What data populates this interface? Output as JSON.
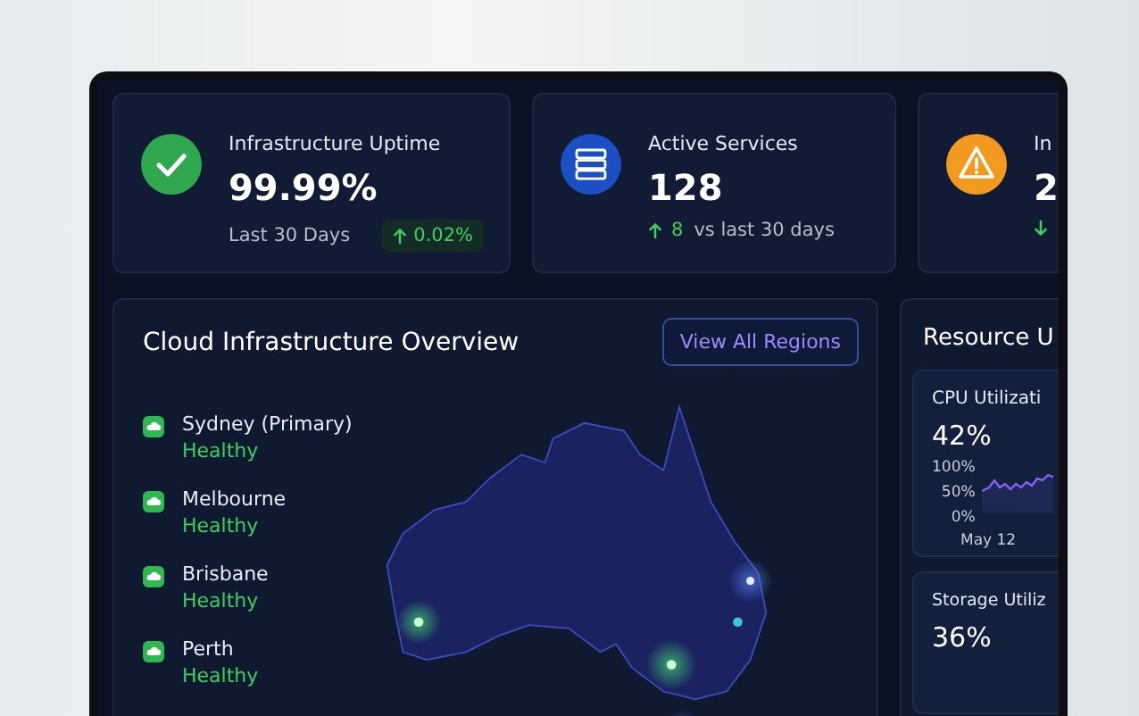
{
  "stat_cards": [
    {
      "kind": "success",
      "title": "Infrastructure Uptime",
      "value": "99.99%",
      "caption": "Last 30 Days",
      "delta": "0.02%",
      "rising": true,
      "highlighted": true
    },
    {
      "kind": "info",
      "title": "Active Services",
      "value": "128",
      "caption": "vs last 30 days",
      "delta": "8",
      "rising": true,
      "highlighted": false
    },
    {
      "kind": "warning",
      "title": "In",
      "value": "2",
      "rising": false,
      "highlighted": false
    }
  ],
  "overview": {
    "title": "Cloud Infrastructure Overview",
    "button": "View All Regions",
    "regions": [
      {
        "name": "Sydney (Primary)",
        "status": "Healthy"
      },
      {
        "name": "Melbourne",
        "status": "Healthy"
      },
      {
        "name": "Brisbane",
        "status": "Healthy"
      },
      {
        "name": "Perth",
        "status": "Healthy"
      }
    ]
  },
  "resources": {
    "title": "Resource U",
    "metrics": [
      {
        "title": "CPU Utilizati",
        "value": "42%",
        "axis_labels": [
          "100%",
          "50%",
          "0%"
        ],
        "date": "May 12"
      },
      {
        "title": "Storage Utiliz",
        "value": "36%"
      }
    ]
  }
}
